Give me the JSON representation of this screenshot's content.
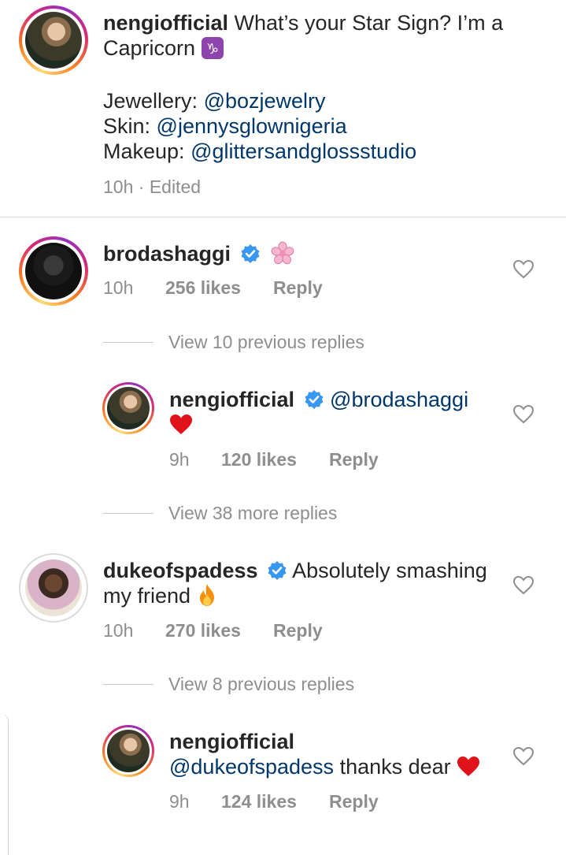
{
  "caption": {
    "username": "nengiofficial",
    "line1": "What’s your Star Sign? I’m a",
    "line2": "Capricorn",
    "zodiac_icon": "capricorn-icon",
    "credits": [
      {
        "label": "Jewellery:",
        "handle": "@bozjewelry"
      },
      {
        "label": "Skin:",
        "handle": "@jennysglownigeria"
      },
      {
        "label": "Makeup:",
        "handle": "@glittersandglossstudio"
      }
    ],
    "time": "10h",
    "edited": "· Edited"
  },
  "comments": [
    {
      "username": "brodashaggi",
      "verified": true,
      "text_icon": "cherry-blossom-icon",
      "time": "10h",
      "likes": "256 likes",
      "reply": "Reply",
      "view_replies": "View 10 previous replies"
    },
    {
      "username": "nengiofficial",
      "verified": true,
      "mention": "@brodashaggi",
      "text_icon": "red-heart-icon",
      "time": "9h",
      "likes": "120 likes",
      "reply": "Reply",
      "view_replies": "View 38 more replies"
    },
    {
      "username": "dukeofspadess",
      "verified": true,
      "text1": "Absolutely smashing",
      "text2": "my friend",
      "text_icon": "fire-icon",
      "time": "10h",
      "likes": "270 likes",
      "reply": "Reply",
      "view_replies": "View 8 previous replies"
    },
    {
      "username": "nengiofficial",
      "verified": false,
      "mention": "@dukeofspadess",
      "text": "thanks dear",
      "text_icon": "red-heart-icon",
      "time": "9h",
      "likes": "124 likes",
      "reply": "Reply"
    }
  ],
  "colors": {
    "link": "#00376b",
    "meta": "#8e8e8e",
    "verified": "#3897f0",
    "heart": "#e0131a"
  }
}
